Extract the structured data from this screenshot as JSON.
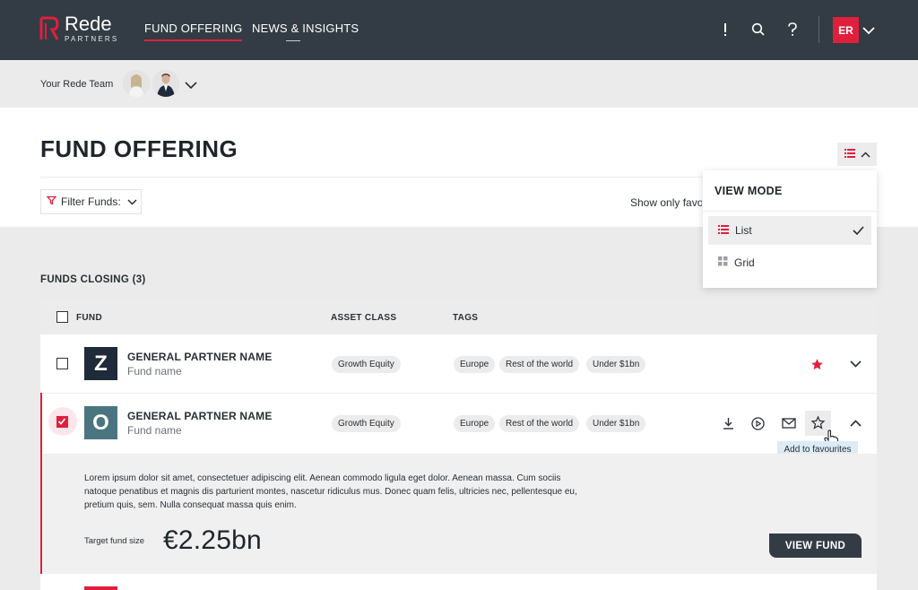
{
  "nav": {
    "brand_name": "Rede",
    "brand_sub": "PARTNERS",
    "links": [
      "FUND OFFERING",
      "NEWS & INSIGHTS"
    ],
    "user_initials": "ER"
  },
  "team": {
    "label": "Your Rede Team"
  },
  "header": {
    "title": "FUND OFFERING",
    "filter_label": "Filter Funds:",
    "show_only_favourites": "Show only favourites"
  },
  "view_mode": {
    "title": "VIEW MODE",
    "options": [
      "List",
      "Grid"
    ],
    "selected": "List"
  },
  "section": {
    "label": "FUNDS CLOSING (3)"
  },
  "table": {
    "columns": [
      "FUND",
      "ASSET CLASS",
      "TAGS"
    ],
    "rows": [
      {
        "logo_letter": "Z",
        "logo_color": "#1f2a3a",
        "gp_name": "GENERAL PARTNER NAME",
        "fund_name": "Fund name",
        "asset_class": "Growth Equity",
        "tags": [
          "Europe",
          "Rest of the world",
          "Under $1bn"
        ],
        "favourite": true,
        "checked": false
      },
      {
        "logo_letter": "O",
        "logo_color": "#4a7580",
        "gp_name": "GENERAL PARTNER NAME",
        "fund_name": "Fund name",
        "asset_class": "Growth Equity",
        "tags": [
          "Europe",
          "Rest of the world",
          "Under $1bn"
        ],
        "favourite": false,
        "checked": true
      }
    ],
    "tooltip": "Add to favourites",
    "expanded": {
      "description": "Lorem ipsum dolor sit amet, consectetuer adipiscing elit. Aenean commodo ligula eget dolor. Aenean massa. Cum sociis natoque penatibus et magnis dis parturient montes, nascetur ridiculus mus. Donec quam felis, ultricies nec, pellentesque eu, pretium quis, sem. Nulla consequat massa quis enim.",
      "target_label": "Target fund size",
      "target_value": "€2.25bn",
      "view_button": "VIEW FUND"
    }
  },
  "colors": {
    "accent": "#e01f3d",
    "nav_bg": "#333c44"
  }
}
